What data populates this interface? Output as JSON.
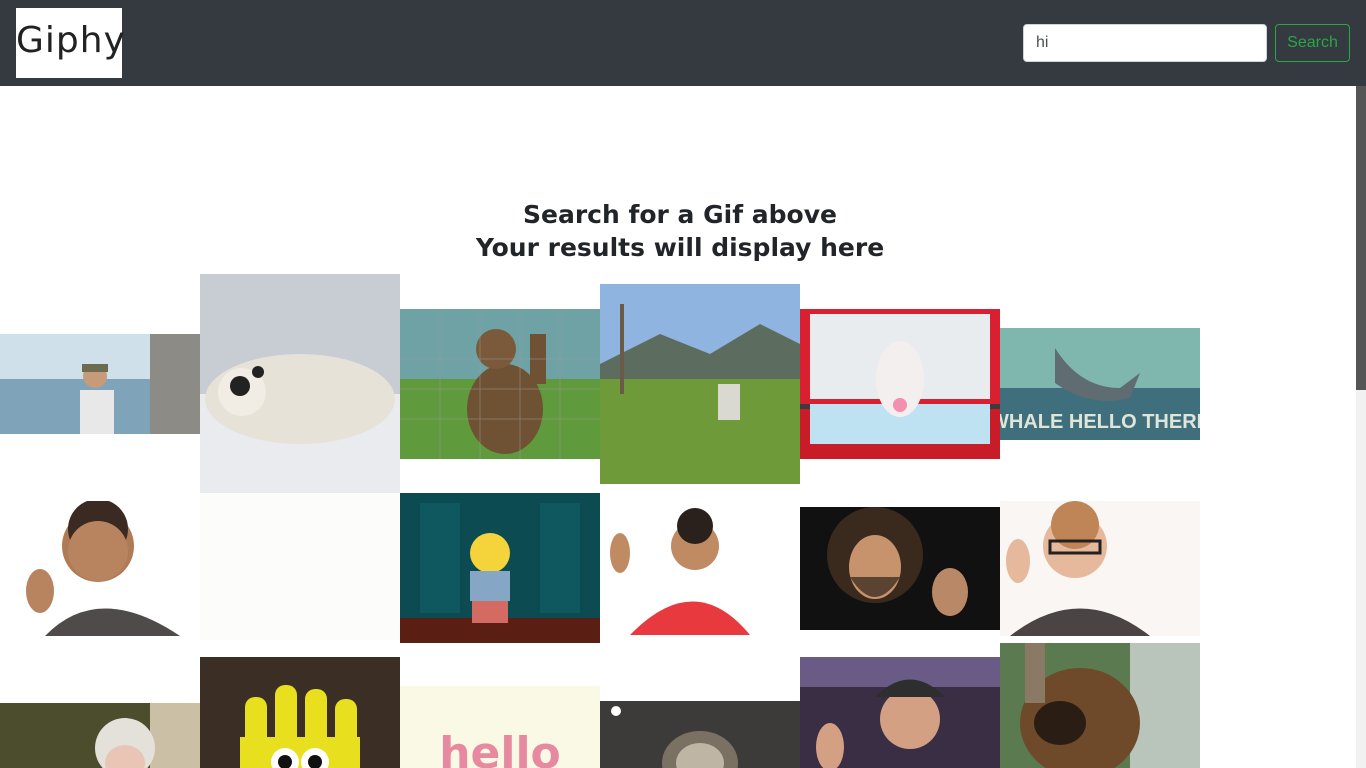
{
  "header": {
    "brand": "Giphy",
    "search": {
      "value": "hi",
      "button_label": "Search"
    }
  },
  "main": {
    "message_line1": "Search for a Gif above",
    "message_line2": "Your results will display here"
  },
  "results": [
    {
      "name": "gif-man-waving-on-boat"
    },
    {
      "name": "gif-seal-in-snow"
    },
    {
      "name": "gif-bear-waving"
    },
    {
      "name": "gif-goat-in-field"
    },
    {
      "name": "gif-cartoon-bird-cooler"
    },
    {
      "name": "gif-whale-hello-there",
      "caption": "WHALE HELLO THERE"
    },
    {
      "name": "gif-kid-waving"
    },
    {
      "name": "gif-blank-white"
    },
    {
      "name": "gif-ralph-waving"
    },
    {
      "name": "gif-man-red-hoodie-waving"
    },
    {
      "name": "gif-bob-ross-waving"
    },
    {
      "name": "gif-kid-glasses-waving"
    },
    {
      "name": "gif-woman-blonde"
    },
    {
      "name": "gif-yellow-hand-eyes"
    },
    {
      "name": "gif-hello-text",
      "caption": "hello"
    },
    {
      "name": "gif-sloth"
    },
    {
      "name": "gif-man-cap-waving"
    },
    {
      "name": "gif-dog-closeup"
    }
  ]
}
